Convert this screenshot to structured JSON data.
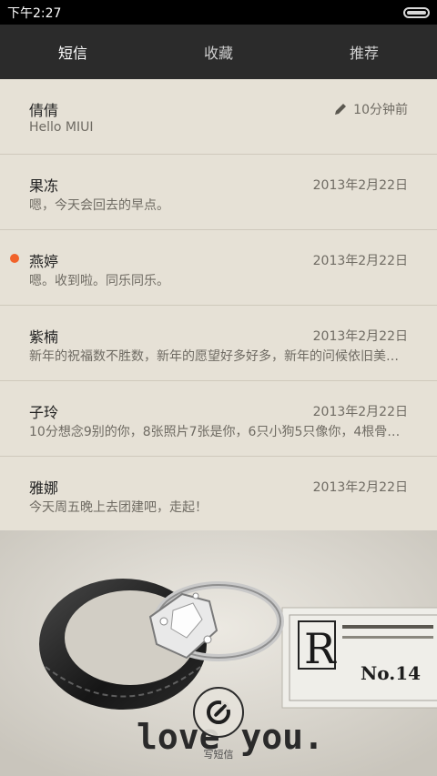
{
  "status": {
    "time": "下午2:27"
  },
  "tabs": [
    {
      "label": "短信",
      "active": true
    },
    {
      "label": "收藏",
      "active": false
    },
    {
      "label": "推荐",
      "active": false
    }
  ],
  "conversations": [
    {
      "name": "倩倩",
      "preview": "Hello MIUI",
      "date": "10分钟前",
      "draft": true,
      "unread": false
    },
    {
      "name": "果冻",
      "preview": "嗯，今天会回去的早点。",
      "date": "2013年2月22日",
      "draft": false,
      "unread": false
    },
    {
      "name": "燕婷",
      "preview": "嗯。收到啦。同乐同乐。",
      "date": "2013年2月22日",
      "draft": false,
      "unread": true
    },
    {
      "name": "紫楠",
      "preview": "新年的祝福数不胜数，新年的愿望好多好多，新年的问候依旧美好…",
      "date": "2013年2月22日",
      "draft": false,
      "unread": false
    },
    {
      "name": "子玲",
      "preview": "10分想念9别的你，8张照片7张是你，6只小狗5只像你，4根骨头…",
      "date": "2013年2月22日",
      "draft": false,
      "unread": false
    },
    {
      "name": "雅娜",
      "preview": "今天周五晚上去团建吧，走起！",
      "date": "2013年2月22日",
      "draft": false,
      "unread": false
    }
  ],
  "photo": {
    "plate_text": "No.14",
    "tag_letter": "R",
    "caption": "love you."
  },
  "compose": {
    "label": "写短信"
  },
  "colors": {
    "unread_dot": "#f1622a",
    "tab_bar": "#2b2b2b",
    "list_bg": "#e6e1d6"
  }
}
